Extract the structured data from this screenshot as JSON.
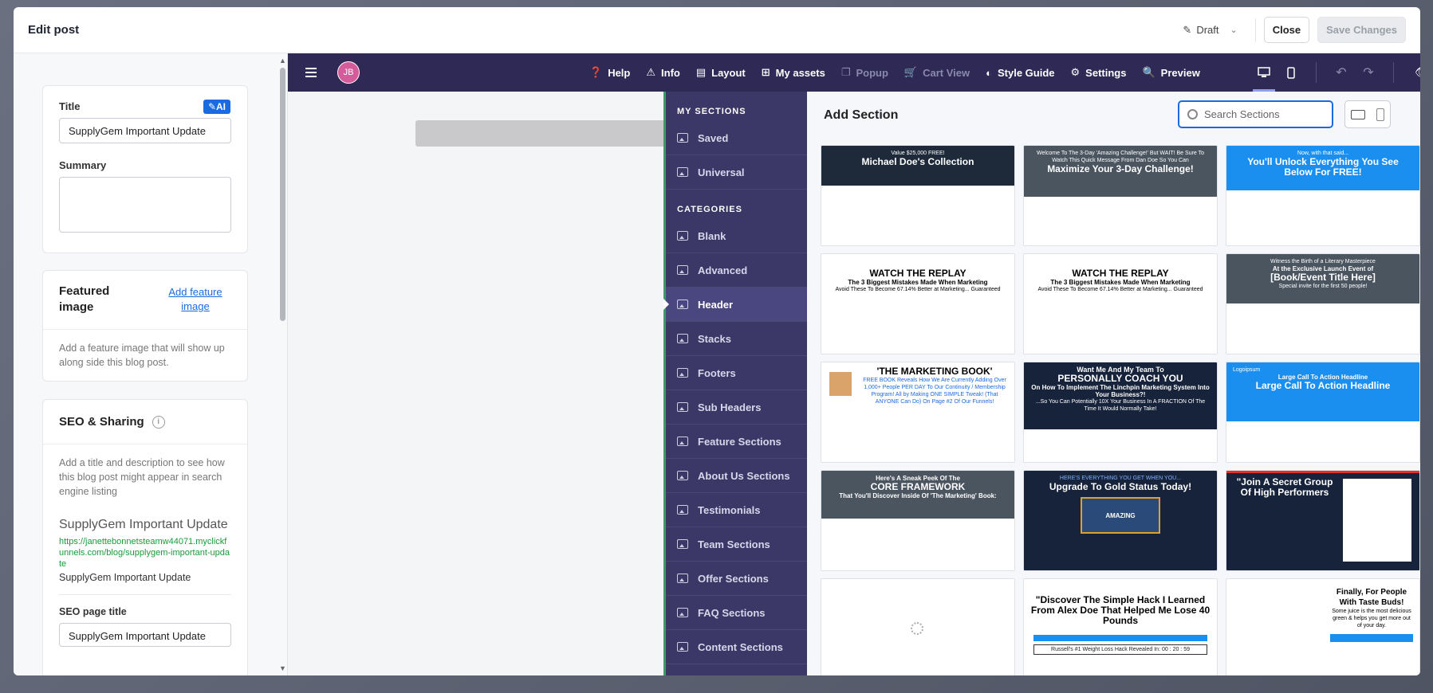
{
  "modal": {
    "title": "Edit post",
    "status": "Draft",
    "close_label": "Close",
    "save_label": "Save Changes"
  },
  "left": {
    "title_label": "Title",
    "ai_badge": "AI",
    "title_value": "SupplyGem Important Update",
    "summary_label": "Summary",
    "featured_title": "Featured image",
    "featured_link": "Add feature image",
    "featured_desc": "Add a feature image that will show up along side this blog post.",
    "seo_title": "SEO & Sharing",
    "seo_desc": "Add a title and description to see how this blog post might appear in search engine listing",
    "seo_preview_title": "SupplyGem Important Update",
    "seo_preview_url": "https://janettebonnetsteamw44071.myclickfunnels.com/blog/supplygem-important-update",
    "seo_preview_desc": "SupplyGem Important Update",
    "seo_page_title_label": "SEO page title",
    "seo_page_title_value": "SupplyGem Important Update"
  },
  "toolbar": {
    "avatar": "JB",
    "items": [
      "Help",
      "Info",
      "Layout",
      "My assets",
      "Popup",
      "Cart View",
      "Style Guide",
      "Settings",
      "Preview"
    ]
  },
  "nav": {
    "my_sections": "MY SECTIONS",
    "saved": "Saved",
    "universal": "Universal",
    "categories": "CATEGORIES",
    "items": [
      "Blank",
      "Advanced",
      "Header",
      "Stacks",
      "Footers",
      "Sub Headers",
      "Feature Sections",
      "About Us Sections",
      "Testimonials",
      "Team Sections",
      "Offer Sections",
      "FAQ Sections",
      "Content Sections"
    ],
    "active": "Header"
  },
  "sections": {
    "title": "Add Section",
    "search_placeholder": "Search Sections",
    "t1_small": "Value $25,000 FREE!",
    "t1_big": "Michael Doe's Collection",
    "t2_small": "Welcome To The 3-Day 'Amazing Challenge!' But WAIT! Be Sure To Watch This Quick Message From Dan Doe So You Can",
    "t2_big": "Maximize Your 3-Day Challenge!",
    "t3_small": "Now, with that said...",
    "t3_big": "You'll Unlock Everything You See Below For FREE!",
    "t4_big": "WATCH THE REPLAY",
    "t4_med": "The 3 Biggest Mistakes Made When Marketing",
    "t4_small": "Avoid These To Become 67.14% Better at Marketing... Guaranteed",
    "t5_big": "WATCH THE REPLAY",
    "t5_med": "The 3 Biggest Mistakes Made When Marketing",
    "t5_small": "Avoid These To Become 67.14% Better at Marketing... Guaranteed",
    "t6_small": "Witness the Birth of a Literary Masterpiece",
    "t6_med": "At the Exclusive Launch Event of",
    "t6_big": "[Book/Event Title Here]",
    "t6_note": "Special invite for the first 50 people!",
    "t7_big": "'THE MARKETING BOOK'",
    "t7_small": "FREE BOOK Reveals How We Are Currently Adding Over 1,000+ People PER DAY To Our Continuity / Membership Program! All by Making ONE SIMPLE Tweak! (That ANYONE Can Do) On Page #2 Of Our Funnels!",
    "t8_small": "Want Me And My Team To",
    "t8_big": "PERSONALLY COACH YOU",
    "t8_med": "On How To Implement The Linchpin Marketing System Into Your Business?!",
    "t8_note": "...So You Can Potentially 10X Your Business In A FRACTION Of The Time It Would Normally Take!",
    "t9_logo": "Logoipsum",
    "t9_small": "Large Call To Action Headline",
    "t9_big": "Large Call To Action Headline",
    "t10_small": "Here's A Sneak Peek Of The",
    "t10_big": "CORE FRAMEWORK",
    "t10_med": "That You'll Discover Inside Of 'The Marketing' Book:",
    "t11_small": "HERE'S EVERYTHING YOU GET WHEN YOU...",
    "t11_big": "Upgrade To Gold Status Today!",
    "t11_label": "AMAZING",
    "t12_big": "\"Join A Secret Group Of High Performers",
    "t14_big": "\"Discover The Simple Hack I Learned From Alex Doe That Helped Me Lose 40 Pounds",
    "t14_timer": "Russell's #1 Weight Loss Hack Revealed In: 00 : 20 : 59",
    "t15_big": "Finally, For People With Taste Buds!",
    "t15_small": "Some juice is the most delicious green & helps you get more out of your day."
  },
  "colors": {
    "toolbar": "#2e2a55",
    "nav": "#3b3766",
    "accent": "#1a6be0"
  }
}
